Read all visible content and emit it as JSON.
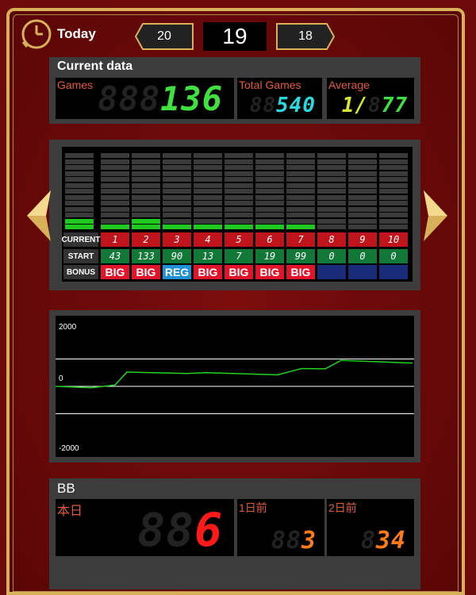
{
  "header": {
    "today_label": "Today",
    "prev_day": "20",
    "current_day": "19",
    "next_day": "18"
  },
  "current_data": {
    "title": "Current data",
    "games_label": "Games",
    "games_value": "136",
    "games_ghost": "888",
    "total_label": "Total Games",
    "total_value": "540",
    "total_ghost": "88",
    "avg_label": "Average",
    "avg_value": "1/",
    "avg_value2": "77",
    "avg_ghost": "8"
  },
  "table": {
    "current_label": "CURRENT",
    "start_label": "START",
    "bonus_label": "BONUS",
    "current": [
      "1",
      "2",
      "3",
      "4",
      "5",
      "6",
      "7",
      "8",
      "9",
      "10"
    ],
    "start": [
      "43",
      "133",
      "90",
      "13",
      "7",
      "19",
      "99",
      "0",
      "0",
      "0"
    ],
    "bonus": [
      "BIG",
      "BIG",
      "REG",
      "BIG",
      "BIG",
      "BIG",
      "BIG",
      "",
      "",
      ""
    ],
    "bar_levels": [
      2,
      1,
      2,
      1,
      1,
      1,
      1,
      1,
      0,
      0,
      0
    ],
    "colors": {
      "big": "#e0142a",
      "reg": "#1e90d8",
      "none": "#1a2b7a",
      "bar_on": "#1ec81e"
    }
  },
  "chart_data": {
    "type": "line",
    "yticks": [
      "2000",
      "0",
      "-2000"
    ],
    "ylim": [
      -2000,
      2000
    ],
    "series": [
      {
        "values": [
          [
            0,
            0
          ],
          [
            45,
            -50
          ],
          [
            75,
            50
          ],
          [
            90,
            520
          ],
          [
            165,
            470
          ],
          [
            190,
            500
          ],
          [
            280,
            420
          ],
          [
            310,
            650
          ],
          [
            340,
            640
          ],
          [
            360,
            950
          ],
          [
            450,
            850
          ]
        ]
      }
    ],
    "color": "#22d322"
  },
  "bb": {
    "title": "BB",
    "today_label": "本日",
    "today_value": "6",
    "today_ghost": "88",
    "day1_label": "1日前",
    "day1_value": "3",
    "day1_ghost": "88",
    "day2_label": "2日前",
    "day2_value": "34",
    "day2_ghost": "8"
  }
}
